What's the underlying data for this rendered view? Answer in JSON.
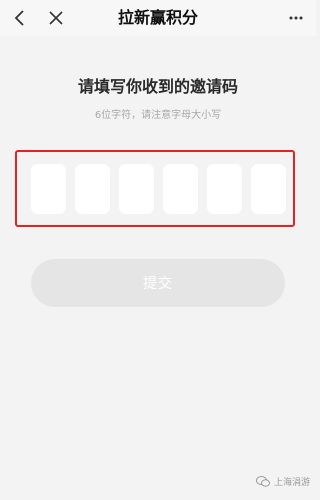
{
  "header": {
    "title": "拉新赢积分"
  },
  "main": {
    "heading": "请填写你收到的邀请码",
    "hint": "6位字符，请注意字母大小写",
    "code_slots": [
      "",
      "",
      "",
      "",
      "",
      ""
    ],
    "submit_label": "提交"
  },
  "watermark": {
    "text": "上海涓游"
  },
  "colors": {
    "highlight_border": "#e02424",
    "submit_disabled_bg": "#e5e5e5"
  }
}
